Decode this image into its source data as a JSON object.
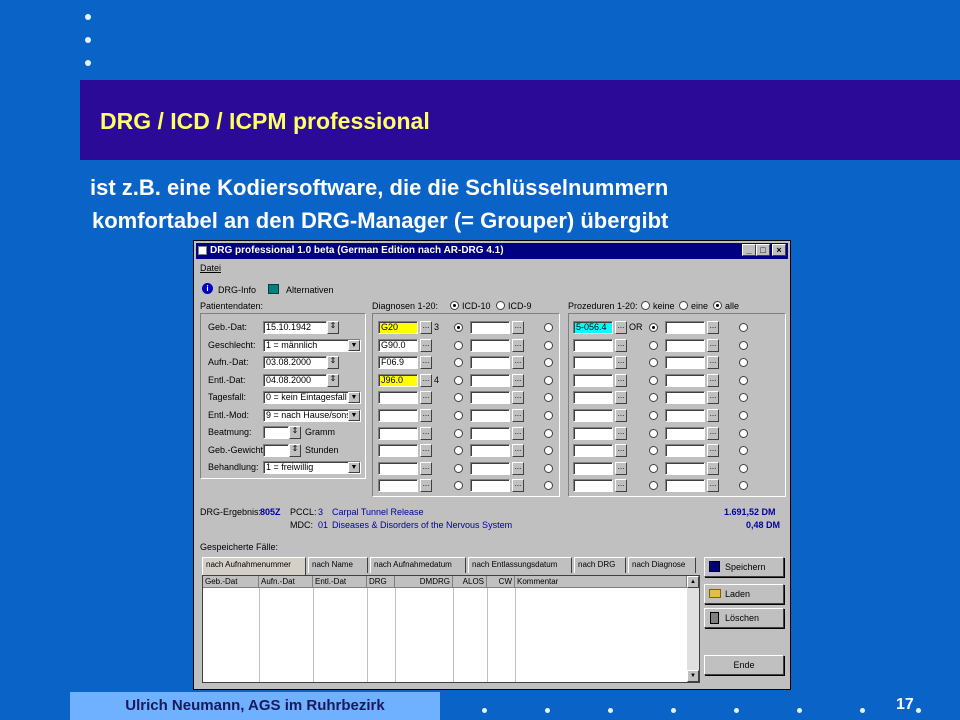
{
  "slide": {
    "title": "DRG / ICD / ICPM professional",
    "subtitle_line1": "ist z.B. eine Kodiersoftware, die die Schlüsselnummern",
    "subtitle_line2": "komfortabel an den DRG-Manager (= Grouper) übergibt",
    "footer": "Ulrich Neumann, AGS im Ruhrbezirk",
    "page_number": "17"
  },
  "window": {
    "title": "DRG professional 1.0 beta (German Edition nach AR-DRG 4.1)",
    "menu_file": "Datei",
    "toolbar": {
      "drg_info": "DRG-Info",
      "alternatives": "Alternativen"
    },
    "patient_label": "Patientendaten:",
    "patient_fields": [
      {
        "label": "Geb.-Dat:",
        "value": "15.10.1942",
        "control": "spin"
      },
      {
        "label": "Geschlecht:",
        "value": "1 = männlich",
        "control": "dropdown"
      },
      {
        "label": "Aufn.-Dat:",
        "value": "03.08.2000",
        "control": "spin"
      },
      {
        "label": "Entl.-Dat:",
        "value": "04.08.2000",
        "control": "spin"
      },
      {
        "label": "Tagesfall:",
        "value": "0 = kein Eintagesfall",
        "control": "dropdown"
      },
      {
        "label": "Entl.-Mod:",
        "value": "9 = nach Hause/sons",
        "control": "dropdown"
      },
      {
        "label": "Beatmung:",
        "value": "",
        "unit": "Gramm",
        "control": "spin"
      },
      {
        "label": "Geb.-Gewicht:",
        "value": "",
        "unit": "Stunden",
        "control": "spin"
      },
      {
        "label": "Behandlung:",
        "value": "1 = freiwillig",
        "control": "dropdown"
      }
    ],
    "diagnoses": {
      "label": "Diagnosen 1-20:",
      "opt_icd10": "ICD-10",
      "opt_icd9": "ICD-9",
      "col1": [
        "G20",
        "G90.0",
        "F06.9",
        "J96.0",
        "",
        "",
        "",
        "",
        "",
        ""
      ],
      "col1_note": [
        "3",
        "",
        "",
        "4",
        "",
        "",
        "",
        "",
        "",
        ""
      ]
    },
    "procedures": {
      "label": "Prozeduren 1-20:",
      "opt_none": "keine",
      "opt_one": "eine",
      "opt_all": "alle",
      "col1": [
        "5-056.4",
        "",
        "",
        "",
        "",
        "",
        "",
        "",
        "",
        ""
      ],
      "col1_note": [
        "OR",
        "",
        "",
        "",
        "",
        "",
        "",
        "",
        "",
        ""
      ]
    },
    "result": {
      "label": "DRG-Ergebnis:",
      "drg": "805Z",
      "pccl_label": "PCCL:",
      "pccl": "3",
      "drg_text": "Carpal Tunnel Release",
      "amount1": "1.691,52 DM",
      "mdc_label": "MDC:",
      "mdc": "01",
      "mdc_text": "Diseases & Disorders of the Nervous System",
      "amount2": "0,48 DM"
    },
    "saved": {
      "label": "Gespeicherte Fälle:",
      "tabs": [
        "nach Aufnahmenummer",
        "nach Name",
        "nach Aufnahmedatum",
        "nach Entlassungsdatum",
        "nach DRG",
        "nach Diagnose"
      ],
      "columns": [
        "Geb.-Dat",
        "Aufn.-Dat",
        "Entl.-Dat",
        "DRG",
        "DMDRG",
        "ALOS",
        "CW",
        "Kommentar"
      ]
    },
    "buttons": {
      "save": "Speichern",
      "load": "Laden",
      "delete": "Löschen",
      "end": "Ende"
    }
  }
}
